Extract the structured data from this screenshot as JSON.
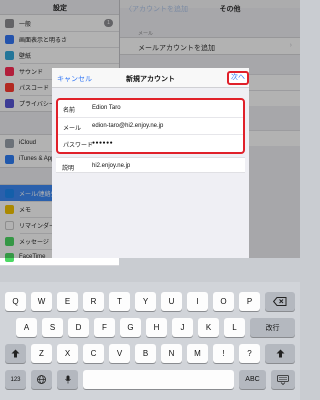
{
  "background": {
    "left_title": "設定",
    "sidebar_group1": [
      {
        "label": "一般",
        "icon": "gear-icon",
        "color": "#8e8e93",
        "badge": "1"
      },
      {
        "label": "画面表示と明るさ",
        "icon": "brightness-icon",
        "color": "#3478f6"
      },
      {
        "label": "壁紙",
        "icon": "wallpaper-icon",
        "color": "#34aadc"
      },
      {
        "label": "サウンド",
        "icon": "sound-icon",
        "color": "#ff2d55"
      },
      {
        "label": "パスコード",
        "icon": "lock-icon",
        "color": "#ff3b30"
      },
      {
        "label": "プライバシー",
        "icon": "hand-icon",
        "color": "#5856d6"
      }
    ],
    "sidebar_group2": [
      {
        "label": "iCloud",
        "icon": "cloud-icon",
        "color": "#9aa3ad"
      },
      {
        "label": "iTunes & App Store",
        "icon": "app-store-icon",
        "color": "#2f7ff6"
      }
    ],
    "sidebar_group3": [
      {
        "label": "メール/連絡先/カレンダー",
        "icon": "mail-icon",
        "color": "#1e88f4",
        "selected": true
      },
      {
        "label": "メモ",
        "icon": "notes-icon",
        "color": "#f5c400"
      },
      {
        "label": "リマインダー",
        "icon": "reminders-icon",
        "color": "#ffffff"
      },
      {
        "label": "メッセージ",
        "icon": "messages-icon",
        "color": "#4cd964"
      },
      {
        "label": "FaceTime",
        "icon": "facetime-icon",
        "color": "#4cd964"
      }
    ],
    "back_label": "〈アカウントを追加",
    "right_title": "その他",
    "mail_section_label": "メール",
    "add_mail_account": "メールアカウントを追加"
  },
  "modal": {
    "cancel_label": "キャンセル",
    "title": "新規アカウント",
    "next_label": "次へ",
    "fields": [
      {
        "label": "名前",
        "value": "Edion Taro"
      },
      {
        "label": "メール",
        "value": "edion-taro@hi2.enjoy.ne.jp"
      },
      {
        "label": "パスワード",
        "value": "●●●●●●"
      }
    ],
    "description_label": "説明",
    "description_value": "hi2.enjoy.ne.jp",
    "highlight_color": "#e0202a",
    "accent_color": "#3478f6"
  },
  "keyboard": {
    "row1": [
      "Q",
      "W",
      "E",
      "R",
      "T",
      "Y",
      "U",
      "I",
      "O",
      "P"
    ],
    "row2": [
      "A",
      "S",
      "D",
      "F",
      "G",
      "H",
      "J",
      "K",
      "L"
    ],
    "row3": [
      "Z",
      "X",
      "C",
      "V",
      "B",
      "N",
      "M",
      "!",
      "?"
    ],
    "return_label": "改行",
    "numbers_label": "123",
    "abc_label": "ABC",
    "shift_icon": "shift-icon",
    "backspace_icon": "backspace-icon",
    "globe_icon": "globe-icon",
    "mic_icon": "microphone-icon",
    "dismiss_icon": "keyboard-dismiss-icon"
  }
}
